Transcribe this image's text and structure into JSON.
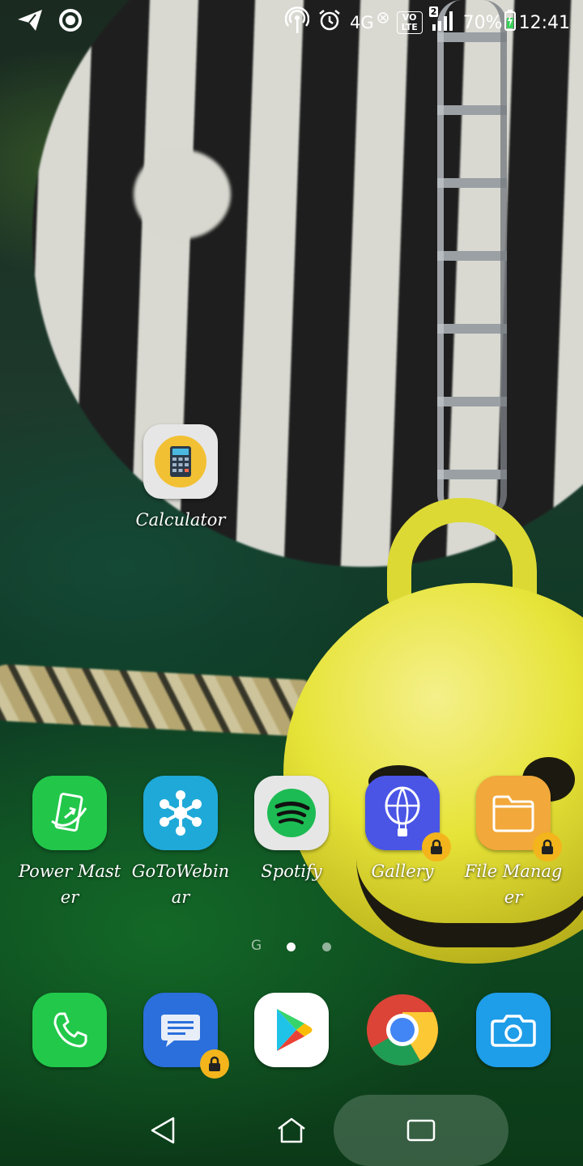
{
  "status_bar": {
    "network": "4G",
    "sim_badge": "2",
    "volte": "VO LTE",
    "battery": "70%",
    "time": "12:41",
    "icons": [
      "telegram-icon",
      "circle-notification-icon",
      "hotspot-icon",
      "alarm-icon",
      "network-x-icon",
      "volte-icon",
      "signal-icon",
      "battery-charging-icon"
    ]
  },
  "home": {
    "calculator": {
      "label": "Calculator",
      "icon": "calculator-icon"
    },
    "row": [
      {
        "label": "Power Master",
        "icon": "power-master-icon",
        "locked": false
      },
      {
        "label": "GoToWebinar",
        "icon": "gotowebinar-icon",
        "locked": false
      },
      {
        "label": "Spotify",
        "icon": "spotify-icon",
        "locked": false
      },
      {
        "label": "Gallery",
        "icon": "gallery-icon",
        "locked": true
      },
      {
        "label": "File Manager",
        "icon": "file-manager-icon",
        "locked": true
      }
    ]
  },
  "page_indicator": {
    "google_page": "G",
    "current_page": 2,
    "pages": 2
  },
  "dock": [
    {
      "name": "phone",
      "icon": "phone-icon",
      "locked": false
    },
    {
      "name": "messages",
      "icon": "messages-icon",
      "locked": true
    },
    {
      "name": "play-store",
      "icon": "play-store-icon",
      "locked": false
    },
    {
      "name": "chrome",
      "icon": "chrome-icon",
      "locked": false
    },
    {
      "name": "camera",
      "icon": "camera-icon",
      "locked": false
    }
  ],
  "navigation": {
    "buttons": [
      "back-icon",
      "home-icon",
      "recents-icon"
    ]
  },
  "colors": {
    "power_master": "#22c74a",
    "gotowebinar": "#1fa9d8",
    "gallery": "#4a55e6",
    "file_manager": "#f2a83a",
    "phone": "#22c84a",
    "messages": "#2a6fdc",
    "camera": "#1e9de8",
    "lock_badge": "#f3b51b"
  }
}
